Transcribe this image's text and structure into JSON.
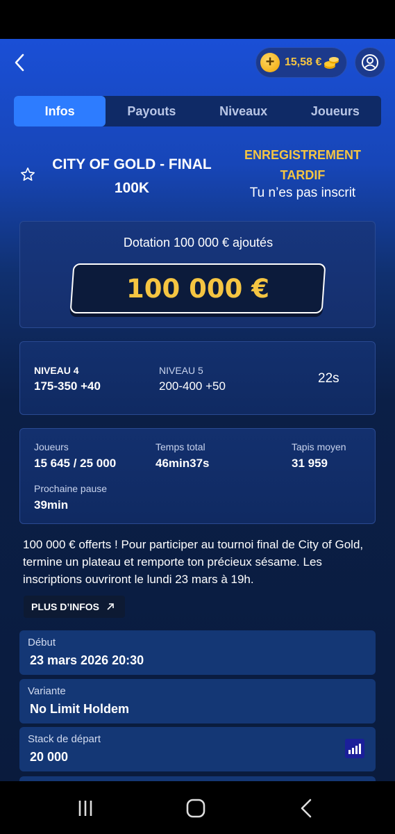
{
  "header": {
    "wallet_amount": "15,58 €"
  },
  "tabs": [
    {
      "label": "Infos",
      "active": true
    },
    {
      "label": "Payouts",
      "active": false
    },
    {
      "label": "Niveaux",
      "active": false
    },
    {
      "label": "Joueurs",
      "active": false
    }
  ],
  "tournament": {
    "title": "CITY OF GOLD - FINAL 100K",
    "registration_status": "ENREGISTREMENT TARDIF",
    "registration_subtitle": "Tu n’es pas inscrit"
  },
  "prize": {
    "label": "Dotation 100 000 € ajoutés",
    "amount": "100 000 €"
  },
  "levels": {
    "current_label": "NIVEAU 4",
    "current_value": "175-350 +40",
    "next_label": "NIVEAU 5",
    "next_value": "200-400 +50",
    "timer": "22s"
  },
  "stats": {
    "players_label": "Joueurs",
    "players_value": "15 645 / 25 000",
    "total_time_label": "Temps total",
    "total_time_value": "46min37s",
    "avg_stack_label": "Tapis moyen",
    "avg_stack_value": "31 959",
    "next_break_label": "Prochaine pause",
    "next_break_value": "39min"
  },
  "description": "100 000 € offerts ! Pour participer au tournoi final de City of Gold, termine un plateau et remporte ton précieux sésame. Les inscriptions ouvriront le lundi 23 mars à 19h.",
  "more_info_label": "PLUS D’INFOS",
  "details": [
    {
      "label": "Début",
      "value": "23 mars 2026 20:30"
    },
    {
      "label": "Variante",
      "value": "No Limit Holdem"
    },
    {
      "label": "Stack de départ",
      "value": "20 000"
    }
  ],
  "colors": {
    "accent_gold": "#f5c542",
    "tab_active": "#2d7cff"
  }
}
